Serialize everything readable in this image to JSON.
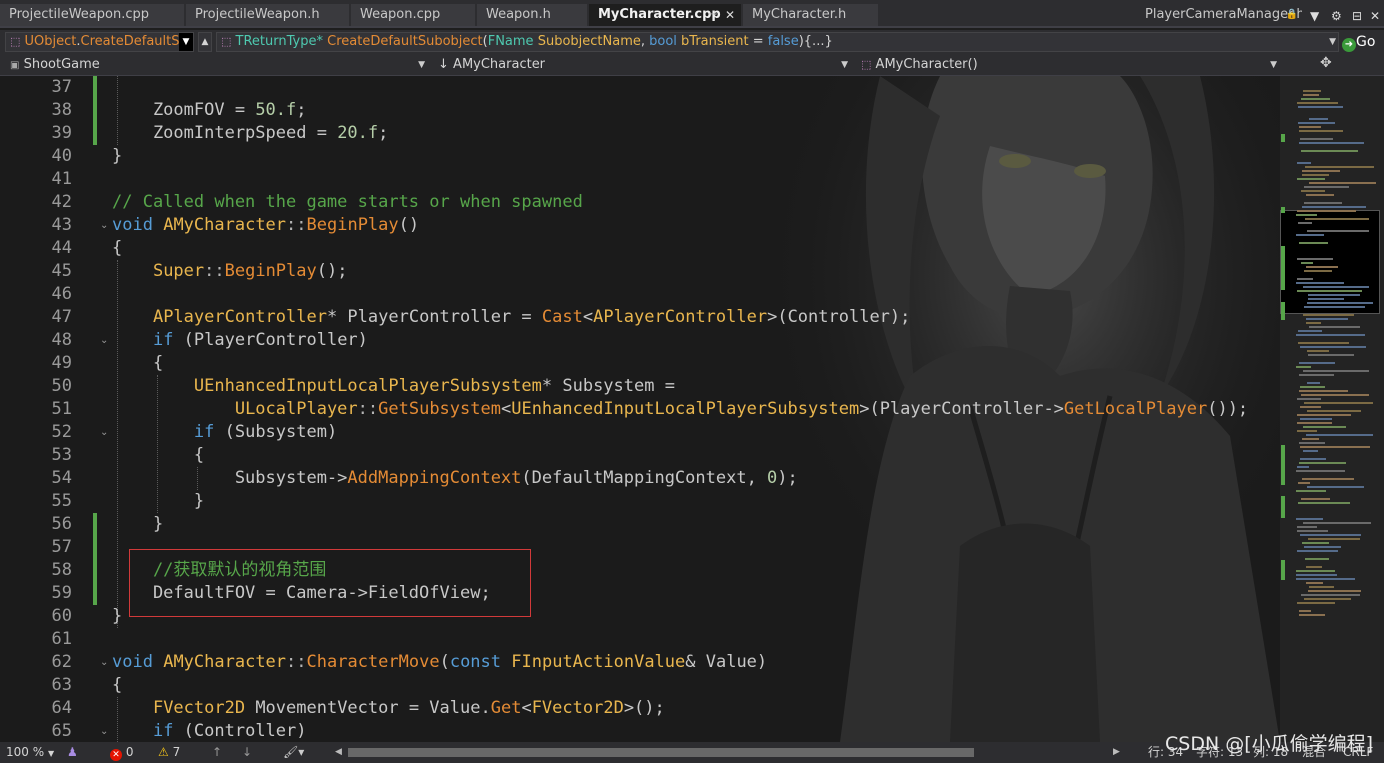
{
  "tabs": [
    {
      "label": "ProjectileWeapon.cpp"
    },
    {
      "label": "ProjectileWeapon.h"
    },
    {
      "label": "Weapon.cpp"
    },
    {
      "label": "Weapon.h"
    },
    {
      "label": "MyCharacter.cpp",
      "active": true
    },
    {
      "label": "MyCharacter.h"
    }
  ],
  "right_tab": {
    "label": "PlayerCameraManager.h"
  },
  "toolbar1": {
    "scope_class": "UObject",
    "scope_sep": ".",
    "scope_func": "CreateDefaultSub",
    "sig_ret": "TReturnType*",
    "sig_name": "CreateDefaultSubobject",
    "sig_p1_type": "FName",
    "sig_p1_name": "SubobjectName",
    "sig_p2_type": "bool",
    "sig_p2_name": "bTransient",
    "sig_eq": " = ",
    "sig_p2_val": "false",
    "sig_tail": "){...}",
    "sig_open": "(",
    "sig_comma": ", ",
    "go_label": "Go"
  },
  "toolbar2": {
    "project": "ShootGame",
    "class_combo": "AMyCharacter",
    "member_combo": "AMyCharacter()"
  },
  "editor": {
    "line_numbers": [
      "37",
      "38",
      "39",
      "40",
      "41",
      "42",
      "43",
      "44",
      "45",
      "46",
      "47",
      "48",
      "49",
      "50",
      "51",
      "52",
      "53",
      "54",
      "55",
      "56",
      "57",
      "58",
      "59",
      "60",
      "61",
      "62",
      "63",
      "64",
      "65"
    ],
    "lines": [
      [],
      [
        [
          "    ZoomFOV",
          ""
        ],
        [
          " = ",
          ""
        ],
        [
          "50.f",
          "num"
        ],
        [
          ";",
          ""
        ]
      ],
      [
        [
          "    ZoomInterpSpeed",
          ""
        ],
        [
          " = ",
          ""
        ],
        [
          "20.f",
          "num"
        ],
        [
          ";",
          ""
        ]
      ],
      [
        [
          "}",
          ""
        ]
      ],
      [],
      [
        [
          "// Called when the game starts or when spawned",
          "com"
        ]
      ],
      [
        [
          "void",
          "kw"
        ],
        [
          " ",
          ""
        ],
        [
          "AMyCharacter",
          "ty"
        ],
        [
          "::",
          "op"
        ],
        [
          "BeginPlay",
          "fn"
        ],
        [
          "()",
          ""
        ]
      ],
      [
        [
          "{",
          ""
        ]
      ],
      [
        [
          "    ",
          ""
        ],
        [
          "Super",
          "ty"
        ],
        [
          "::",
          "op"
        ],
        [
          "BeginPlay",
          "fn"
        ],
        [
          "();",
          ""
        ]
      ],
      [],
      [
        [
          "    ",
          ""
        ],
        [
          "APlayerController",
          "ty"
        ],
        [
          "* PlayerController = ",
          ""
        ],
        [
          "Cast",
          "fn"
        ],
        [
          "<",
          ""
        ],
        [
          "APlayerController",
          "ty"
        ],
        [
          ">(Controller);",
          ""
        ]
      ],
      [
        [
          "    ",
          ""
        ],
        [
          "if",
          "kw"
        ],
        [
          " (PlayerController)",
          ""
        ]
      ],
      [
        [
          "    {",
          ""
        ]
      ],
      [
        [
          "        ",
          ""
        ],
        [
          "UEnhancedInputLocalPlayerSubsystem",
          "ty"
        ],
        [
          "* Subsystem =",
          ""
        ]
      ],
      [
        [
          "            ",
          ""
        ],
        [
          "ULocalPlayer",
          "ty"
        ],
        [
          "::",
          "op"
        ],
        [
          "GetSubsystem",
          "fn"
        ],
        [
          "<",
          ""
        ],
        [
          "UEnhancedInputLocalPlayerSubsystem",
          "ty"
        ],
        [
          ">(PlayerController->",
          ""
        ],
        [
          "GetLocalPlayer",
          "fn"
        ],
        [
          "());",
          ""
        ]
      ],
      [
        [
          "        ",
          ""
        ],
        [
          "if",
          "kw"
        ],
        [
          " (Subsystem)",
          ""
        ]
      ],
      [
        [
          "        {",
          ""
        ]
      ],
      [
        [
          "            Subsystem->",
          ""
        ],
        [
          "AddMappingContext",
          "fn"
        ],
        [
          "(DefaultMappingContext, ",
          ""
        ],
        [
          "0",
          "num"
        ],
        [
          ");",
          ""
        ]
      ],
      [
        [
          "        }",
          ""
        ]
      ],
      [
        [
          "    }",
          ""
        ]
      ],
      [],
      [
        [
          "    //获取默认的视角范围",
          "com"
        ]
      ],
      [
        [
          "    DefaultFOV = Camera->FieldOfView;",
          ""
        ]
      ],
      [
        [
          "}",
          ""
        ]
      ],
      [],
      [
        [
          "void",
          "kw"
        ],
        [
          " ",
          ""
        ],
        [
          "AMyCharacter",
          "ty"
        ],
        [
          "::",
          "op"
        ],
        [
          "CharacterMove",
          "fn"
        ],
        [
          "(",
          ""
        ],
        [
          "const",
          "kw"
        ],
        [
          " ",
          ""
        ],
        [
          "FInputActionValue",
          "ty"
        ],
        [
          "& Value)",
          ""
        ]
      ],
      [
        [
          "{",
          ""
        ]
      ],
      [
        [
          "    ",
          ""
        ],
        [
          "FVector2D",
          "ty"
        ],
        [
          " MovementVector = Value.",
          ""
        ],
        [
          "Get",
          "fn"
        ],
        [
          "<",
          ""
        ],
        [
          "FVector2D",
          "ty"
        ],
        [
          ">();",
          ""
        ]
      ],
      [
        [
          "    ",
          ""
        ],
        [
          "if",
          "kw"
        ],
        [
          " (Controller)",
          ""
        ]
      ]
    ]
  },
  "status": {
    "zoom": "100 %",
    "errors": "0",
    "warnings": "7",
    "line": "行: 34",
    "char": "字符: 13",
    "col": "列: 18",
    "mixed": "混合",
    "eol": "CRLF"
  },
  "watermark": "CSDN @[小瓜偷学编程]",
  "colors": {
    "comment": "#57a64a",
    "keyword": "#569cd6",
    "function": "#e48b35",
    "type": "#e9b64e",
    "change_marker": "#57a64a",
    "highlight_box": "#d23a3a"
  }
}
